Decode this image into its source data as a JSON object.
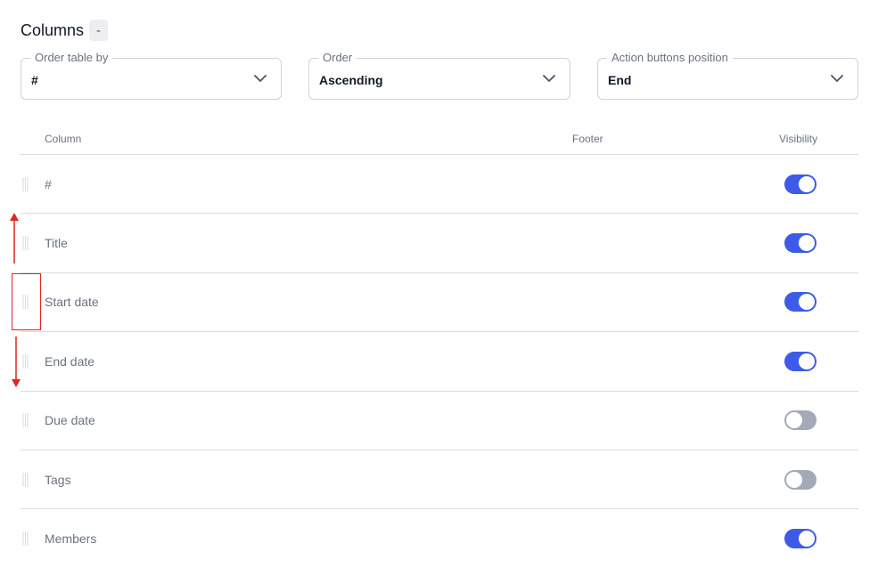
{
  "header": {
    "title": "Columns",
    "collapse_label": "-"
  },
  "selects": [
    {
      "label": "Order table by",
      "value": "#"
    },
    {
      "label": "Order",
      "value": "Ascending"
    },
    {
      "label": "Action buttons position",
      "value": "End"
    }
  ],
  "table": {
    "headers": {
      "column": "Column",
      "footer": "Footer",
      "visibility": "Visibility"
    },
    "rows": [
      {
        "label": "#",
        "visible": true
      },
      {
        "label": "Title",
        "visible": true
      },
      {
        "label": "Start date",
        "visible": true
      },
      {
        "label": "End date",
        "visible": true
      },
      {
        "label": "Due date",
        "visible": false
      },
      {
        "label": "Tags",
        "visible": false
      },
      {
        "label": "Members",
        "visible": true
      }
    ]
  },
  "colors": {
    "toggle_on": "#3d5be8",
    "toggle_off": "#a3a9b6",
    "annotation": "#e02424"
  },
  "icons": {
    "select_chevron": "chevron-down-icon",
    "drag": "drag-handle-icon",
    "annotation_arrows": "arrow-icon"
  }
}
